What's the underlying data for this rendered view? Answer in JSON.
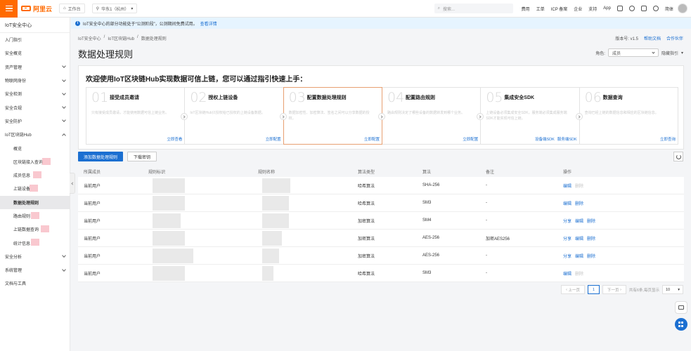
{
  "topbar": {
    "logo": "阿里云",
    "workbench": "工作台",
    "region": "华东1（杭州）",
    "search_placeholder": "搜索...",
    "links": [
      "费用",
      "工单",
      "ICP 备案",
      "企业",
      "支持",
      "App"
    ],
    "lang": "简体"
  },
  "sidebar": {
    "title": "IoT安全中心",
    "items": [
      {
        "label": "入门指引",
        "type": "top",
        "expandable": false
      },
      {
        "label": "安全概览",
        "type": "top",
        "expandable": false
      },
      {
        "label": "资产管理",
        "type": "top",
        "expandable": true
      },
      {
        "label": "物联网身份",
        "type": "top",
        "expandable": true
      },
      {
        "label": "安全检测",
        "type": "top",
        "expandable": true
      },
      {
        "label": "安全合规",
        "type": "top",
        "expandable": true
      },
      {
        "label": "安全防护",
        "type": "top",
        "expandable": true
      },
      {
        "label": "IoT区块链Hub",
        "type": "top",
        "expandable": true,
        "expanded": true
      },
      {
        "label": "概览",
        "type": "sub"
      },
      {
        "label": "区块链接入查询",
        "type": "sub"
      },
      {
        "label": "成员信息",
        "type": "sub"
      },
      {
        "label": "上链设备",
        "type": "sub"
      },
      {
        "label": "数据处理规则",
        "type": "sub",
        "active": true
      },
      {
        "label": "路由规则",
        "type": "sub"
      },
      {
        "label": "上链数据查询",
        "type": "sub"
      },
      {
        "label": "统计信息",
        "type": "sub"
      },
      {
        "label": "安全分析",
        "type": "top",
        "expandable": true
      },
      {
        "label": "系统管理",
        "type": "top",
        "expandable": true
      },
      {
        "label": "文档与工具",
        "type": "top",
        "expandable": false
      }
    ]
  },
  "notice": {
    "text": "IoT安全中心的部分功能处于“公测阶段”，公测期间免费试用。",
    "link": "查看详情"
  },
  "header": {
    "breadcrumb": [
      "IoT安全中心",
      "IoT区块链Hub",
      "数据处理规则"
    ],
    "title": "数据处理规则",
    "version": "版本号: v1.5",
    "help": "帮助文档",
    "partner": "合作伙伴",
    "role_label": "角色:",
    "role_value": "成员",
    "hide_guide": "隐藏指引"
  },
  "guide": {
    "title": "欢迎使用IoT区块链Hub实现数据可信上链，您可以通过指引快速上手：",
    "steps": [
      {
        "num": "01",
        "title": "接受成员邀请",
        "desc": "只有接受成员邀请，才能使用数据可信上链业务。",
        "links": [
          "立即查看"
        ]
      },
      {
        "num": "02",
        "title": "授权上链设备",
        "desc": "IoT区块链Hub只授权给已授权的上链设备数据。",
        "links": [
          "立即配置"
        ]
      },
      {
        "num": "03",
        "title": "配置数据处理规则",
        "desc": "数据加密性、加密算法、签名之间可以分享数据的授权。",
        "links": [
          "立即配置"
        ],
        "highlight": true
      },
      {
        "num": "04",
        "title": "配置路由规则",
        "desc": "路由规则决定了哪些设备的数据转发到哪个业务。",
        "links": [
          "立即配置"
        ]
      },
      {
        "num": "05",
        "title": "集成安全SDK",
        "desc": "上链设备必须集成安全SDK，服务端必须集成服务端SDK才能实现可信上链。",
        "links": [
          "设备端SDK",
          "服务端SDK"
        ]
      },
      {
        "num": "06",
        "title": "数据查询",
        "desc": "查询已经上链的数据信息和相应的区块链信息。",
        "links": [
          "立即查询"
        ]
      }
    ]
  },
  "actions": {
    "add": "添加数据处理规则",
    "download": "下载密钥"
  },
  "table": {
    "columns": [
      "所属成员",
      "规则标识",
      "规则名称",
      "算法类型",
      "算法",
      "备注",
      "操作"
    ],
    "rows": [
      {
        "member": "当前用户",
        "type": "哈希算法",
        "algo": "SHA-256",
        "note": "-",
        "ops": [
          {
            "label": "编辑",
            "enabled": true
          },
          {
            "label": "删除",
            "enabled": false
          }
        ]
      },
      {
        "member": "当前用户",
        "type": "哈希算法",
        "algo": "SM3",
        "note": "-",
        "ops": [
          {
            "label": "编辑",
            "enabled": true
          },
          {
            "label": "删除",
            "enabled": true
          }
        ]
      },
      {
        "member": "当前用户",
        "type": "加密算法",
        "algo": "SM4",
        "note": "-",
        "ops": [
          {
            "label": "分享",
            "enabled": true
          },
          {
            "label": "编辑",
            "enabled": true
          },
          {
            "label": "删除",
            "enabled": true
          }
        ]
      },
      {
        "member": "当前用户",
        "type": "加密算法",
        "algo": "AES-256",
        "note": "加密AES256",
        "ops": [
          {
            "label": "分享",
            "enabled": true
          },
          {
            "label": "编辑",
            "enabled": true
          },
          {
            "label": "删除",
            "enabled": true
          }
        ]
      },
      {
        "member": "当前用户",
        "type": "加密算法",
        "algo": "AES-256",
        "note": "-",
        "ops": [
          {
            "label": "分享",
            "enabled": true
          },
          {
            "label": "编辑",
            "enabled": true
          },
          {
            "label": "删除",
            "enabled": true
          }
        ]
      },
      {
        "member": "当前用户",
        "type": "哈希算法",
        "algo": "SM3",
        "note": "-",
        "ops": [
          {
            "label": "编辑",
            "enabled": true
          },
          {
            "label": "删除",
            "enabled": false
          }
        ]
      }
    ]
  },
  "pagination": {
    "prev": "上一页",
    "page": "1",
    "next": "下一页",
    "summary": "共有6条,每页显示",
    "page_size": "10"
  },
  "colors": {
    "brand": "#ff6a00",
    "primary": "#1b6fd1"
  }
}
